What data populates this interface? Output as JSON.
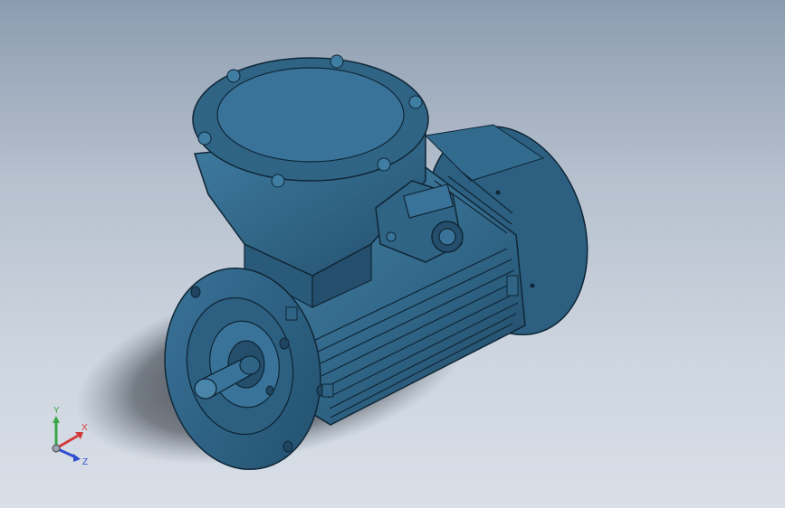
{
  "viewport": {
    "background_top": "#8c9cb0",
    "background_bottom": "#d9dfe7",
    "model_color": "#2f6485",
    "model_highlight": "#4a86aa",
    "model_shadow": "#1f4560"
  },
  "triad": {
    "x_label": "X",
    "y_label": "Y",
    "z_label": "Z",
    "x_color": "#d23a3a",
    "y_color": "#3aa648",
    "z_color": "#2f4fd0"
  }
}
